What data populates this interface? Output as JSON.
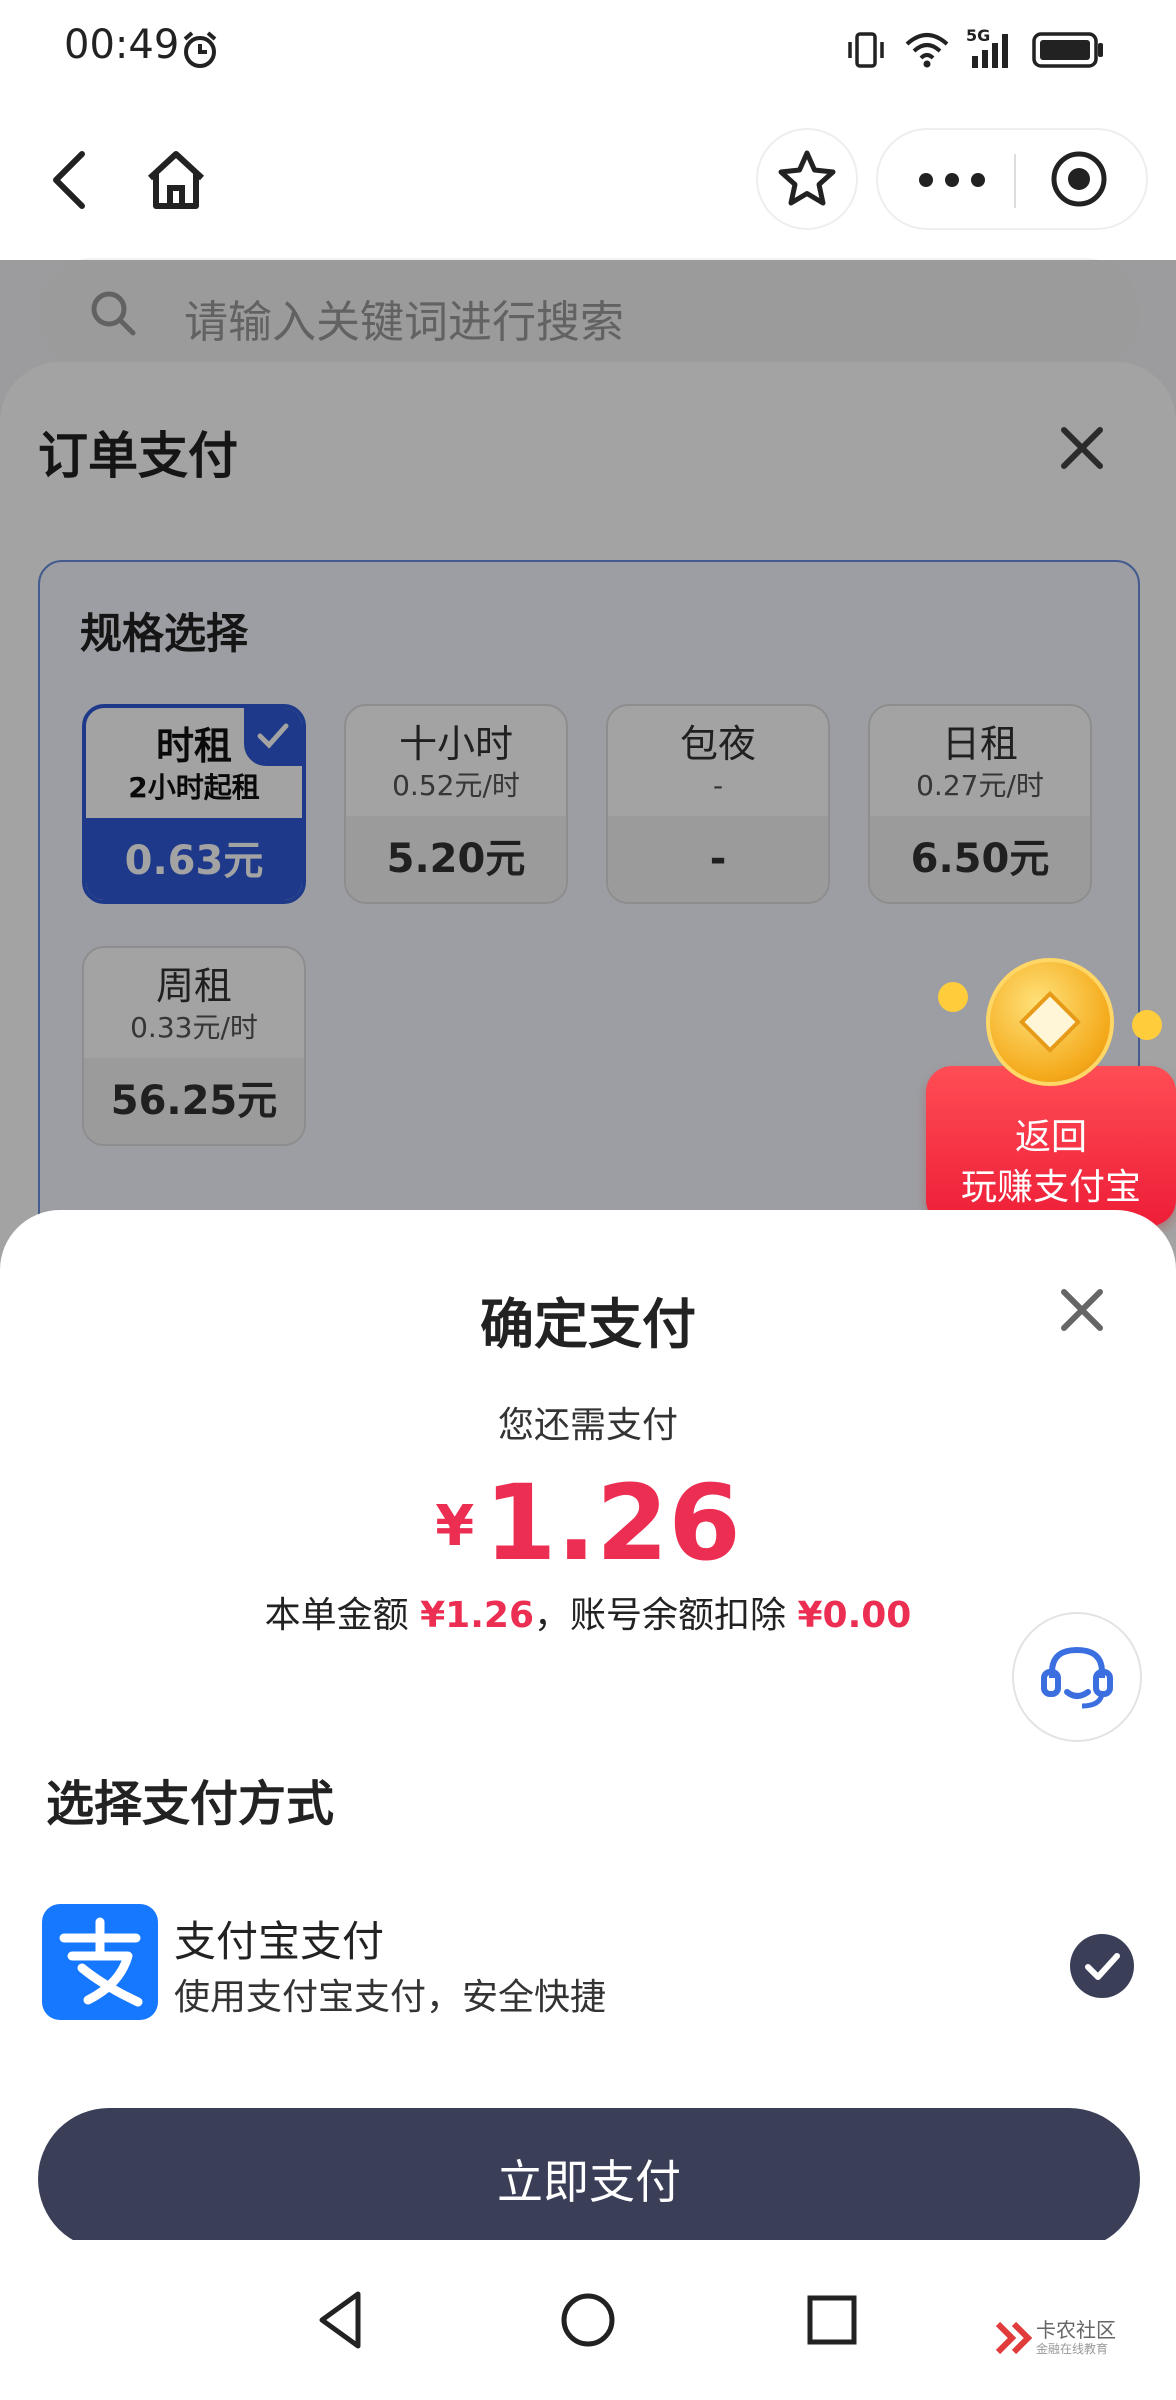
{
  "status_bar": {
    "time": "00:49",
    "network": "5G"
  },
  "nav": {
    "back": "back-icon",
    "home": "home-icon",
    "favorite": "star-icon",
    "more": "more-icon",
    "close_miniapp": "target-icon"
  },
  "search": {
    "placeholder": "请输入关键词进行搜索"
  },
  "order": {
    "title": "订单支付",
    "spec_title": "规格选择",
    "options": [
      {
        "name": "时租",
        "sub": "2小时起租",
        "price": "0.63元",
        "selected": true
      },
      {
        "name": "十小时",
        "sub": "0.52元/时",
        "price": "5.20元",
        "selected": false
      },
      {
        "name": "包夜",
        "sub": "-",
        "price": "-",
        "selected": false
      },
      {
        "name": "日租",
        "sub": "0.27元/时",
        "price": "6.50元",
        "selected": false
      },
      {
        "name": "周租",
        "sub": "0.33元/时",
        "price": "56.25元",
        "selected": false
      }
    ]
  },
  "promo": {
    "line1": "返回",
    "line2": "玩赚支付宝"
  },
  "pay": {
    "title": "确定支付",
    "need_pay_label": "您还需支付",
    "currency": "¥",
    "amount": "1.26",
    "detail_label1": "本单金额",
    "detail_value1": "¥1.26",
    "detail_sep": "，账号余额扣除",
    "detail_value2": "¥0.00",
    "method_title": "选择支付方式",
    "method_name": "支付宝支付",
    "method_desc": "使用支付宝支付，安全快捷",
    "submit": "立即支付"
  },
  "watermark": {
    "text": "卡农社区",
    "sub": "金融在线教育"
  },
  "colors": {
    "accent_blue": "#2f5ad6",
    "price_red": "#ec2e52",
    "button_dark": "#3a3f57",
    "alipay_blue": "#1677ff"
  }
}
